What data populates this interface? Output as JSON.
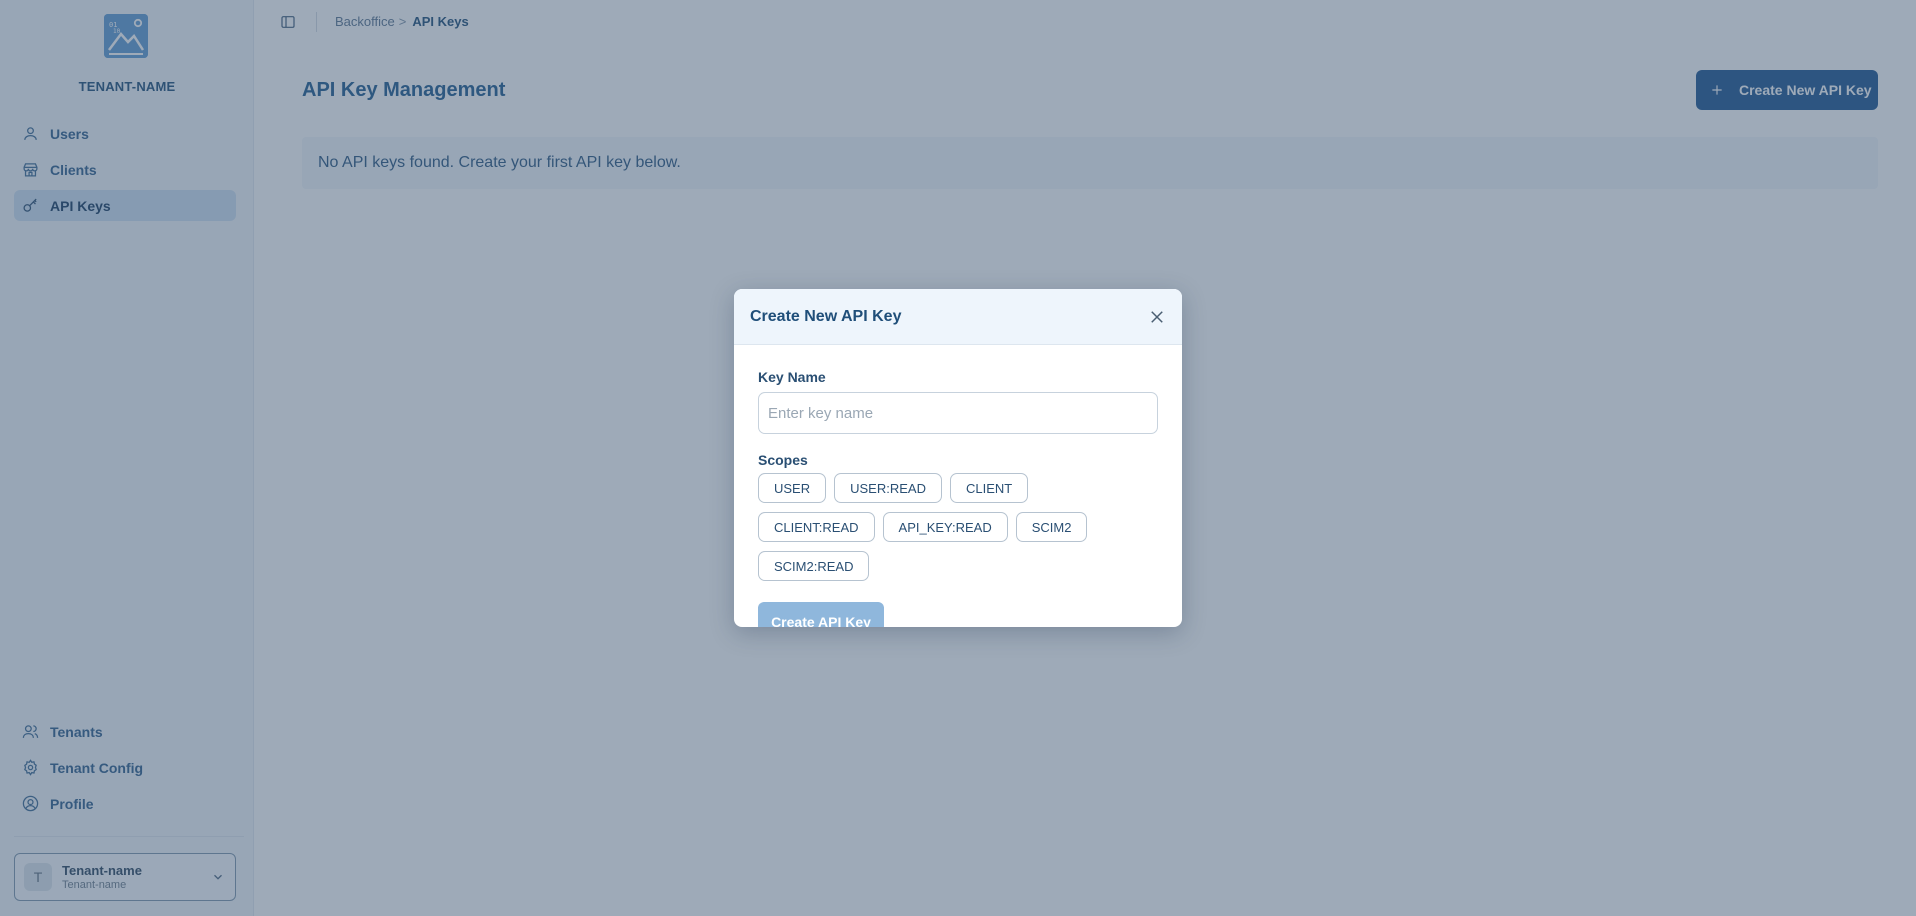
{
  "sidebar": {
    "tenant_title": "TENANT-NAME",
    "nav_top": [
      {
        "label": "Users",
        "icon": "user-icon"
      },
      {
        "label": "Clients",
        "icon": "store-icon"
      },
      {
        "label": "API Keys",
        "icon": "key-icon",
        "active": true
      }
    ],
    "nav_bottom": [
      {
        "label": "Tenants",
        "icon": "users-icon"
      },
      {
        "label": "Tenant Config",
        "icon": "gear-icon"
      },
      {
        "label": "Profile",
        "icon": "profile-icon"
      }
    ],
    "tenant_switcher": {
      "avatar": "T",
      "name": "Tenant-name",
      "sub": "Tenant-name"
    }
  },
  "breadcrumb": {
    "parent": "Backoffice",
    "separator": ">",
    "current": "API Keys"
  },
  "main": {
    "title": "API Key Management",
    "create_button": "Create New API Key",
    "empty_message": "No API keys found. Create your first API key below."
  },
  "modal": {
    "title": "Create New API Key",
    "key_name_label": "Key Name",
    "key_name_placeholder": "Enter key name",
    "key_name_value": "",
    "scopes_label": "Scopes",
    "scopes": [
      "USER",
      "USER:READ",
      "CLIENT",
      "CLIENT:READ",
      "API_KEY:READ",
      "SCIM2",
      "SCIM2:READ"
    ],
    "submit_label": "Create API Key"
  },
  "colors": {
    "accent": "#1d5590",
    "active_nav_bg": "#cfe1f2",
    "disabled_button": "#8fb7dc",
    "overlay": "#3e5672"
  }
}
